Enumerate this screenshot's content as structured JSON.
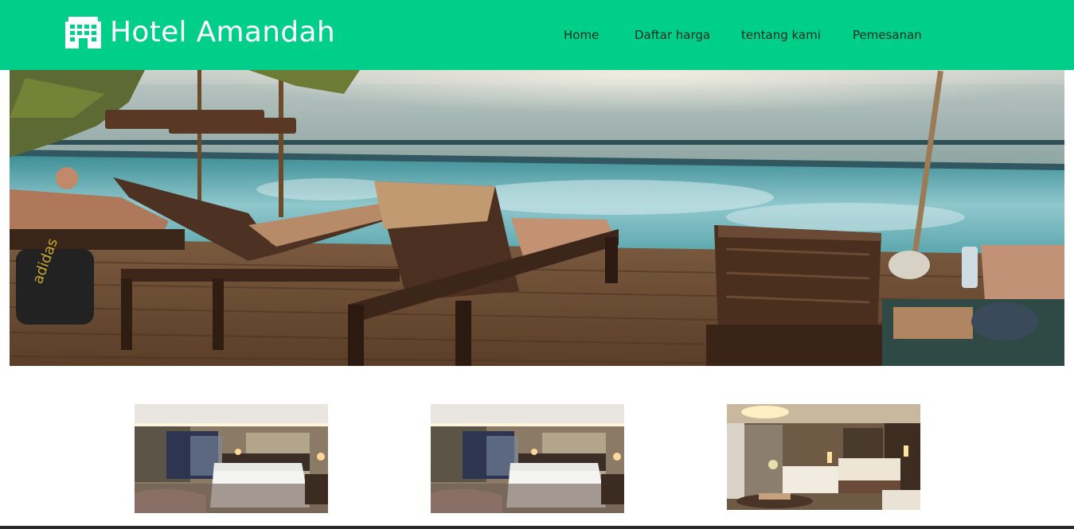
{
  "brand": {
    "name": "Hotel Amandah",
    "icon": "hotel-building-icon",
    "text_color": "#ffffff"
  },
  "theme": {
    "navbar_bg": "#00cf89",
    "nav_text": "#1d2b24"
  },
  "nav": {
    "items": [
      {
        "label": "Home"
      },
      {
        "label": "Daftar harga"
      },
      {
        "label": "tentang kami"
      },
      {
        "label": "Pemesanan"
      }
    ]
  },
  "hero": {
    "image": "infinity-pool-deck-with-sun-loungers-and-sea-view"
  },
  "rooms": [
    {
      "image": "hotel-room-white-bed-1"
    },
    {
      "image": "hotel-room-white-bed-2"
    },
    {
      "image": "hotel-suite-lounge-sofa"
    }
  ]
}
